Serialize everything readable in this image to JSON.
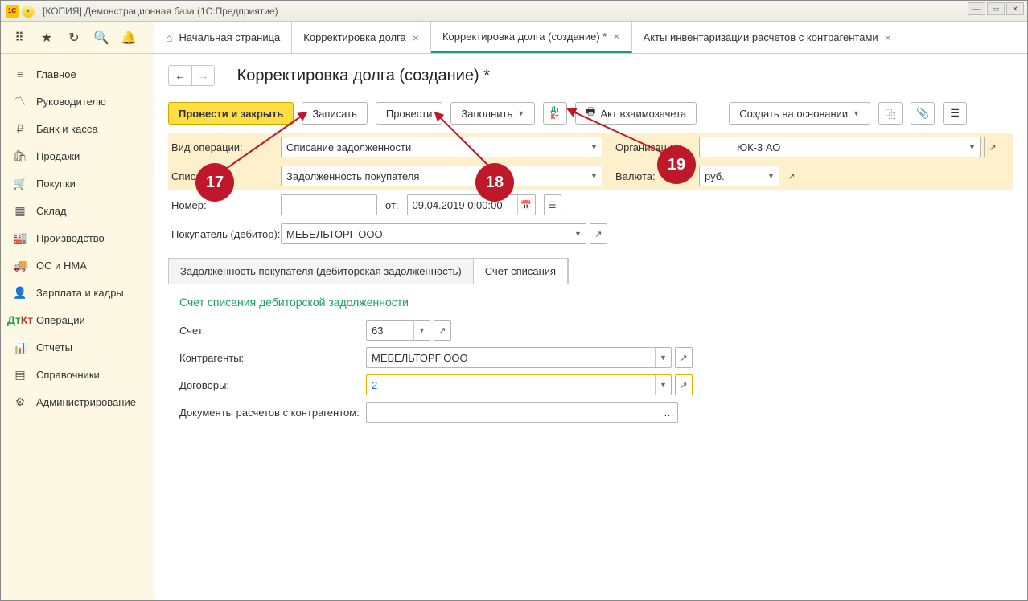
{
  "window": {
    "title": "[КОПИЯ] Демонстрационная база  (1С:Предприятие)"
  },
  "tabs": {
    "home": "Начальная страница",
    "t1": "Корректировка долга",
    "t2": "Корректировка долга (создание) *",
    "t3": "Акты инвентаризации расчетов с контрагентами"
  },
  "sidebar": [
    "Главное",
    "Руководителю",
    "Банк и касса",
    "Продажи",
    "Покупки",
    "Склад",
    "Производство",
    "ОС и НМА",
    "Зарплата и кадры",
    "Операции",
    "Отчеты",
    "Справочники",
    "Администрирование"
  ],
  "page": {
    "title": "Корректировка долга (создание) *"
  },
  "toolbar": {
    "post_close": "Провести и закрыть",
    "write": "Записать",
    "post": "Провести",
    "fill": "Заполнить",
    "act": "Акт взаимозачета",
    "create_based": "Создать на основании"
  },
  "labels": {
    "op_type": "Вид операции:",
    "write_off": "Списать:",
    "number": "Номер:",
    "from": "от:",
    "buyer": "Покупатель (дебитор):",
    "org": "Организация:",
    "currency": "Валюта:",
    "account": "Счет:",
    "counterparty": "Контрагенты:",
    "contracts": "Договоры:",
    "docs": "Документы расчетов с контрагентом:"
  },
  "values": {
    "op_type": "Списание задолженности",
    "write_off": "Задолженность покупателя",
    "date": "09.04.2019  0:00:00",
    "buyer": "МЕБЕЛЬТОРГ ООО",
    "org": "ЮК-3 АО",
    "currency": "руб.",
    "account": "63",
    "counterparty": "МЕБЕЛЬТОРГ ООО",
    "contracts": "2"
  },
  "inner_tabs": {
    "t1": "Задолженность покупателя (дебиторская задолженность)",
    "t2": "Счет списания"
  },
  "section": {
    "heading": "Счет списания дебиторской задолженности"
  },
  "annotations": {
    "a17": "17",
    "a18": "18",
    "a19": "19"
  }
}
